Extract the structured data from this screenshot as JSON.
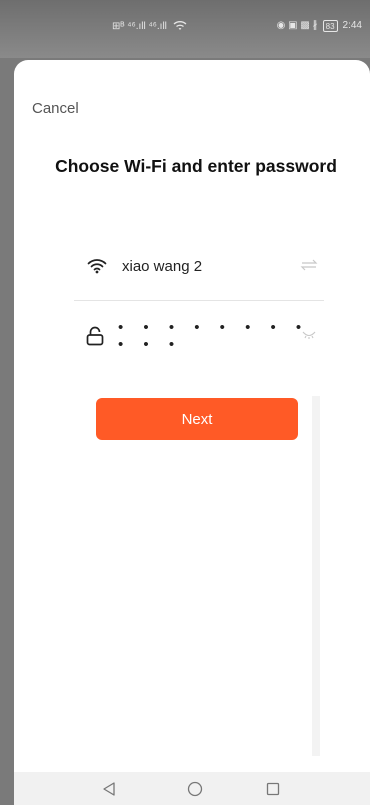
{
  "status_bar": {
    "left_text": "⊞ᴮ ⁴⁶.ıll ⁴⁶.ıll",
    "right_icons": "◉ ▣ ▩ ∦",
    "battery": "83",
    "time": "2:44"
  },
  "header": {
    "cancel_label": "Cancel",
    "title": "Choose Wi-Fi and enter password"
  },
  "wifi": {
    "icon": "wifi-icon",
    "network_name": "xiao wang 2",
    "switch_icon": "swap-icon"
  },
  "password": {
    "icon": "lock-icon",
    "masked_value": "• • • • • • • • • • •",
    "toggle_icon": "eye-closed-icon"
  },
  "actions": {
    "next_label": "Next",
    "next_color": "#ff5a26"
  },
  "nav": {
    "back_icon": "back-triangle-icon",
    "home_icon": "home-circle-icon",
    "recents_icon": "recents-square-icon"
  }
}
